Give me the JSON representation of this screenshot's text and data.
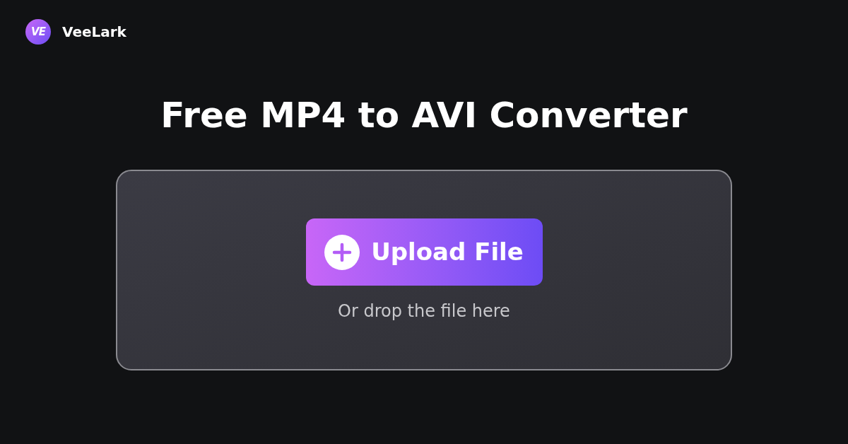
{
  "brand": {
    "logo_text": "VE",
    "name": "VeeLark"
  },
  "title": "Free MP4 to AVI Converter",
  "dropzone": {
    "button": "Upload File",
    "hint": "Or drop the file here"
  }
}
